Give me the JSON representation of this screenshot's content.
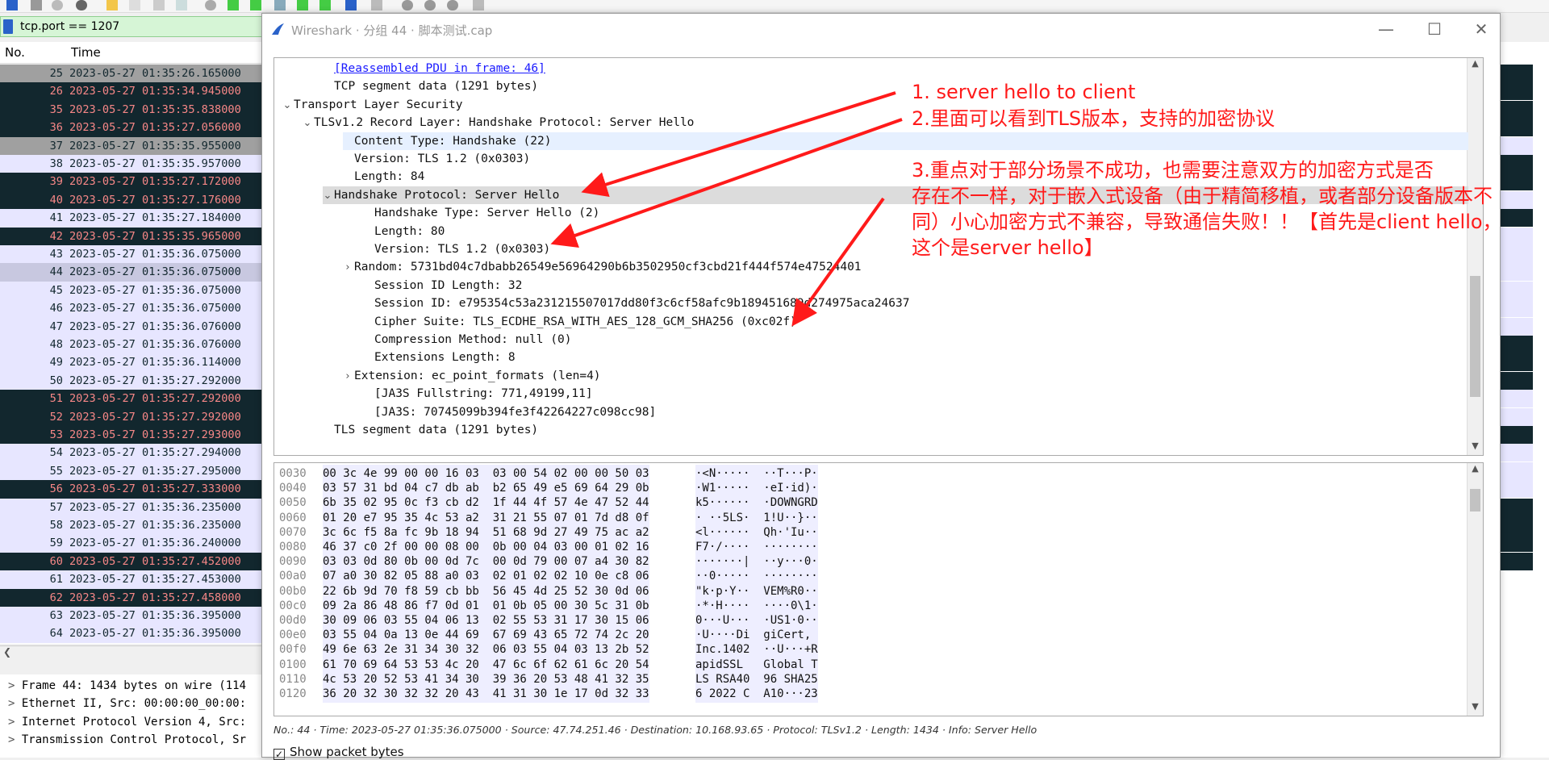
{
  "filter": {
    "value": "tcp.port == 1207"
  },
  "list_header": {
    "no": "No.",
    "time": "Time"
  },
  "packets": [
    {
      "no": "25",
      "time": "2023-05-27 01:35:26.165000",
      "style": "grey"
    },
    {
      "no": "26",
      "time": "2023-05-27 01:35:34.945000",
      "style": "dark"
    },
    {
      "no": "35",
      "time": "2023-05-27 01:35:35.838000",
      "style": "dark"
    },
    {
      "no": "36",
      "time": "2023-05-27 01:35:27.056000",
      "style": "dark"
    },
    {
      "no": "37",
      "time": "2023-05-27 01:35:35.955000",
      "style": "grey"
    },
    {
      "no": "38",
      "time": "2023-05-27 01:35:35.957000",
      "style": "lav"
    },
    {
      "no": "39",
      "time": "2023-05-27 01:35:27.172000",
      "style": "dark"
    },
    {
      "no": "40",
      "time": "2023-05-27 01:35:27.176000",
      "style": "dark"
    },
    {
      "no": "41",
      "time": "2023-05-27 01:35:27.184000",
      "style": "lav"
    },
    {
      "no": "42",
      "time": "2023-05-27 01:35:35.965000",
      "style": "dark"
    },
    {
      "no": "43",
      "time": "2023-05-27 01:35:36.075000",
      "style": "lav"
    },
    {
      "no": "44",
      "time": "2023-05-27 01:35:36.075000",
      "style": "sel"
    },
    {
      "no": "45",
      "time": "2023-05-27 01:35:36.075000",
      "style": "lav"
    },
    {
      "no": "46",
      "time": "2023-05-27 01:35:36.075000",
      "style": "lav"
    },
    {
      "no": "47",
      "time": "2023-05-27 01:35:36.076000",
      "style": "lav"
    },
    {
      "no": "48",
      "time": "2023-05-27 01:35:36.076000",
      "style": "lav"
    },
    {
      "no": "49",
      "time": "2023-05-27 01:35:36.114000",
      "style": "lav"
    },
    {
      "no": "50",
      "time": "2023-05-27 01:35:27.292000",
      "style": "lav"
    },
    {
      "no": "51",
      "time": "2023-05-27 01:35:27.292000",
      "style": "dark"
    },
    {
      "no": "52",
      "time": "2023-05-27 01:35:27.292000",
      "style": "dark"
    },
    {
      "no": "53",
      "time": "2023-05-27 01:35:27.293000",
      "style": "dark"
    },
    {
      "no": "54",
      "time": "2023-05-27 01:35:27.294000",
      "style": "lav"
    },
    {
      "no": "55",
      "time": "2023-05-27 01:35:27.295000",
      "style": "lav"
    },
    {
      "no": "56",
      "time": "2023-05-27 01:35:27.333000",
      "style": "dark"
    },
    {
      "no": "57",
      "time": "2023-05-27 01:35:36.235000",
      "style": "lav"
    },
    {
      "no": "58",
      "time": "2023-05-27 01:35:36.235000",
      "style": "lav"
    },
    {
      "no": "59",
      "time": "2023-05-27 01:35:36.240000",
      "style": "lav"
    },
    {
      "no": "60",
      "time": "2023-05-27 01:35:27.452000",
      "style": "dark"
    },
    {
      "no": "61",
      "time": "2023-05-27 01:35:27.453000",
      "style": "lav"
    },
    {
      "no": "62",
      "time": "2023-05-27 01:35:27.458000",
      "style": "dark"
    },
    {
      "no": "63",
      "time": "2023-05-27 01:35:36.395000",
      "style": "lav"
    },
    {
      "no": "64",
      "time": "2023-05-27 01:35:36.395000",
      "style": "lav"
    }
  ],
  "left_details": [
    "Frame 44: 1434 bytes on wire (114",
    "Ethernet II, Src: 00:00:00_00:00:",
    "Internet Protocol Version 4, Src:",
    "Transmission Control Protocol, Sr"
  ],
  "dialog": {
    "title": "Wireshark · 分组 44 · 脚本测试.cap",
    "minimize": "—",
    "maximize": "☐",
    "close": "✕"
  },
  "tree": [
    {
      "indent": 2,
      "arrow": "",
      "text": "[Reassembled PDU in frame: 46]",
      "link": true
    },
    {
      "indent": 2,
      "arrow": "",
      "text": "TCP segment data (1291 bytes)"
    },
    {
      "indent": 0,
      "arrow": "v",
      "text": "Transport Layer Security"
    },
    {
      "indent": 1,
      "arrow": "v",
      "text": "TLSv1.2 Record Layer: Handshake Protocol: Server Hello"
    },
    {
      "indent": 3,
      "arrow": "",
      "text": "Content Type: Handshake (22)",
      "hl": "blue"
    },
    {
      "indent": 3,
      "arrow": "",
      "text": "Version: TLS 1.2 (0x0303)"
    },
    {
      "indent": 3,
      "arrow": "",
      "text": "Length: 84"
    },
    {
      "indent": 2,
      "arrow": "v",
      "text": "Handshake Protocol: Server Hello",
      "hl": "grey"
    },
    {
      "indent": 4,
      "arrow": "",
      "text": "Handshake Type: Server Hello (2)"
    },
    {
      "indent": 4,
      "arrow": "",
      "text": "Length: 80"
    },
    {
      "indent": 4,
      "arrow": "",
      "text": "Version: TLS 1.2 (0x0303)"
    },
    {
      "indent": 3,
      "arrow": ">",
      "text": "Random: 5731bd04c7dbabb26549e56964290b6b3502950cf3cbd21f444f574e47524401"
    },
    {
      "indent": 4,
      "arrow": "",
      "text": "Session ID Length: 32"
    },
    {
      "indent": 4,
      "arrow": "",
      "text": "Session ID: e795354c53a231215507017dd80f3c6cf58afc9b189451689d274975aca24637"
    },
    {
      "indent": 4,
      "arrow": "",
      "text": "Cipher Suite: TLS_ECDHE_RSA_WITH_AES_128_GCM_SHA256 (0xc02f)"
    },
    {
      "indent": 4,
      "arrow": "",
      "text": "Compression Method: null (0)"
    },
    {
      "indent": 4,
      "arrow": "",
      "text": "Extensions Length: 8"
    },
    {
      "indent": 3,
      "arrow": ">",
      "text": "Extension: ec_point_formats (len=4)"
    },
    {
      "indent": 4,
      "arrow": "",
      "text": "[JA3S Fullstring: 771,49199,11]"
    },
    {
      "indent": 4,
      "arrow": "",
      "text": "[JA3S: 70745099b394fe3f42264227c098cc98]"
    },
    {
      "indent": 2,
      "arrow": "",
      "text": "TLS segment data (1291 bytes)"
    }
  ],
  "bytes": [
    {
      "off": "0030",
      "hex": "00 3c 4e 99 00 00 16 03  03 00 54 02 00 00 50 03",
      "ascii": "·<N·····  ··T···P·"
    },
    {
      "off": "0040",
      "hex": "03 57 31 bd 04 c7 db ab  b2 65 49 e5 69 64 29 0b",
      "ascii": "·W1·····  ·eI·id)·"
    },
    {
      "off": "0050",
      "hex": "6b 35 02 95 0c f3 cb d2  1f 44 4f 57 4e 47 52 44",
      "ascii": "k5······  ·DOWNGRD"
    },
    {
      "off": "0060",
      "hex": "01 20 e7 95 35 4c 53 a2  31 21 55 07 01 7d d8 0f",
      "ascii": "· ··5LS·  1!U··}··"
    },
    {
      "off": "0070",
      "hex": "3c 6c f5 8a fc 9b 18 94  51 68 9d 27 49 75 ac a2",
      "ascii": "<l······  Qh·'Iu··"
    },
    {
      "off": "0080",
      "hex": "46 37 c0 2f 00 00 08 00  0b 00 04 03 00 01 02 16",
      "ascii": "F7·/····  ········"
    },
    {
      "off": "0090",
      "hex": "03 03 0d 80 0b 00 0d 7c  00 0d 79 00 07 a4 30 82",
      "ascii": "·······|  ··y···0·"
    },
    {
      "off": "00a0",
      "hex": "07 a0 30 82 05 88 a0 03  02 01 02 02 10 0e c8 06",
      "ascii": "··0·····  ········"
    },
    {
      "off": "00b0",
      "hex": "22 6b 9d 70 f8 59 cb bb  56 45 4d 25 52 30 0d 06",
      "ascii": "\"k·p·Y··  VEM%R0··"
    },
    {
      "off": "00c0",
      "hex": "09 2a 86 48 86 f7 0d 01  01 0b 05 00 30 5c 31 0b",
      "ascii": "·*·H····  ····0\\1·"
    },
    {
      "off": "00d0",
      "hex": "30 09 06 03 55 04 06 13  02 55 53 31 17 30 15 06",
      "ascii": "0···U···  ·US1·0··"
    },
    {
      "off": "00e0",
      "hex": "03 55 04 0a 13 0e 44 69  67 69 43 65 72 74 2c 20",
      "ascii": "·U····Di  giCert, "
    },
    {
      "off": "00f0",
      "hex": "49 6e 63 2e 31 34 30 32  06 03 55 04 03 13 2b 52",
      "ascii": "Inc.1402  ··U···+R"
    },
    {
      "off": "0100",
      "hex": "61 70 69 64 53 53 4c 20  47 6c 6f 62 61 6c 20 54",
      "ascii": "apidSSL   Global T"
    },
    {
      "off": "0110",
      "hex": "4c 53 20 52 53 41 34 30  39 36 20 53 48 41 32 35",
      "ascii": "LS RSA40  96 SHA25"
    },
    {
      "off": "0120",
      "hex": "36 20 32 30 32 32 20 43  41 31 30 1e 17 0d 32 33",
      "ascii": "6 2022 C  A10···23"
    }
  ],
  "status": "No.: 44 · Time: 2023-05-27 01:35:36.075000 · Source: 47.74.251.46 · Destination: 10.168.93.65 · Protocol: TLSv1.2 · Length: 1434 · Info: Server Hello",
  "show_bytes": {
    "label": "Show packet bytes",
    "checked": true
  },
  "annotations": {
    "a1": "1. server hello to client",
    "a2": "2.里面可以看到TLS版本，支持的加密协议",
    "a3_l1": "3.重点对于部分场景不成功，也需要注意双方的加密方式是否",
    "a3_l2": "存在不一样，对于嵌入式设备（由于精简移植，或者部分设备版本不",
    "a3_l3": "同）小心加密方式不兼容，导致通信失败！！【首先是client hello，",
    "a3_l4": "这个是server hello】"
  },
  "colors": {
    "annotation": "#ff1a1a",
    "dark_row": "#12272e",
    "lavender_row": "#e7e6ff",
    "filter_bg": "#d6f5d6"
  }
}
